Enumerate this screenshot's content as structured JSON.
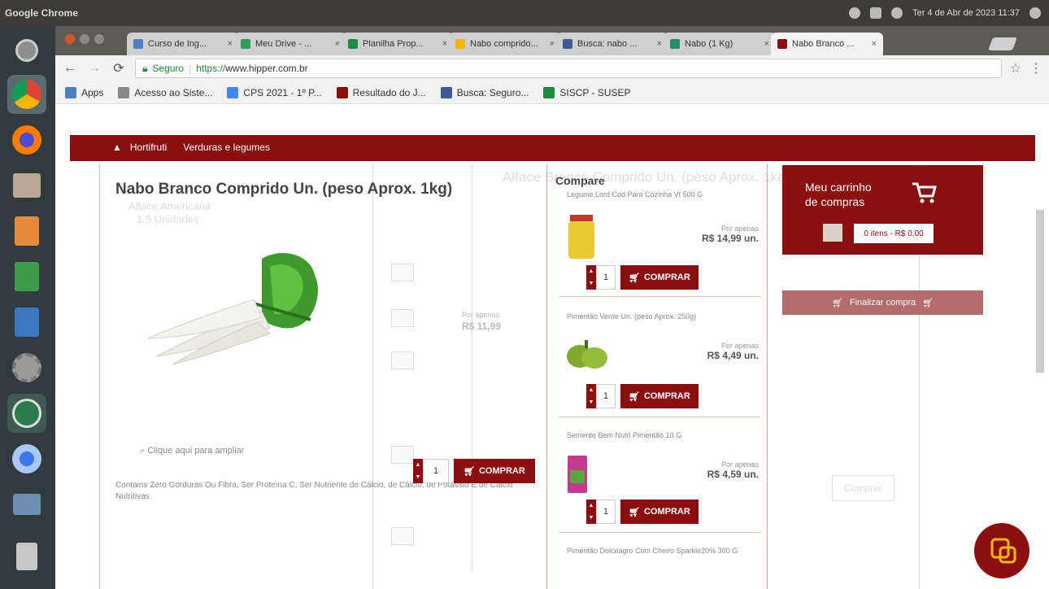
{
  "top_panel": {
    "app_name": "Google Chrome",
    "datetime": "Ter 4 de Abr de 2023 11:37"
  },
  "tabs": [
    {
      "label": "Curso de Ing...",
      "favicon_color": "#4e7fbf"
    },
    {
      "label": "Meu Drive - ...",
      "favicon_color": "#2f9e5a"
    },
    {
      "label": "Planilha Prop...",
      "favicon_color": "#1e8e3e"
    },
    {
      "label": "Nabo comprido...",
      "favicon_color": "#f2b705"
    },
    {
      "label": "Busca: nabo ...",
      "favicon_color": "#3b5998"
    },
    {
      "label": "Nabo (1 Kg)",
      "favicon_color": "#2b8a6e"
    },
    {
      "label": "Nabo Branco ...",
      "favicon_color": "#8b0f0f"
    }
  ],
  "toolbar": {
    "secure_label": "Seguro",
    "url_scheme": "https://",
    "url_host": "www.hipper.com.br"
  },
  "bookmarks": [
    {
      "label": "Apps",
      "color": "#4e7fbf"
    },
    {
      "label": "Acesso ao Siste...",
      "color": "#888888"
    },
    {
      "label": "CPS 2021 - 1º P...",
      "color": "#4285f4"
    },
    {
      "label": "Resultado do J...",
      "color": "#8b0f0f"
    },
    {
      "label": "Busca: Seguro...",
      "color": "#3b5998"
    },
    {
      "label": "SISCP - SUSEP",
      "color": "#1e8e3e"
    }
  ],
  "breadcrumb": {
    "home": "Hortifruti",
    "current": "Verduras e legumes"
  },
  "product": {
    "title": "Nabo Branco Comprido Un. (peso Aprox. 1kg)",
    "zoom_hint": "Clique aqui para ampliar",
    "description": "Contains Zero Gorduras Ou Fibra, Ser Proteína C, Ser Nutriente de Cálcio, de Cálcio, de Potássio E de Cálcio Nutritivas.",
    "qty": "1",
    "buy_label": "COMPRAR",
    "ghost_price_label": "Por apenas",
    "ghost_price": "R$ 11,99"
  },
  "compare": {
    "title": "Compare",
    "items": [
      {
        "name": "Legume Lord Cod Para Cozinha Vt 500 G",
        "price_label": "Por apenas",
        "price": "R$ 14,99 un.",
        "qty": "1",
        "buy_label": "COMPRAR"
      },
      {
        "name": "Pimentão Verde Un. (peso Aprox. 250g)",
        "price_label": "Por apenas",
        "price": "R$ 4,49 un.",
        "qty": "1",
        "buy_label": "COMPRAR"
      },
      {
        "name": "Semente Bem Nutri Pimentão 10 G",
        "price_label": "Por apenas",
        "price": "R$ 4,59 un.",
        "qty": "1",
        "buy_label": "COMPRAR"
      }
    ],
    "last_item_name": "Pimentão Dolceagro Com Cheiro Sparkle20% 300 G"
  },
  "cart": {
    "title_line1": "Meu carrinho",
    "title_line2": "de compras",
    "items_summary": "0 itens - R$ 0,00",
    "checkout_label": "Finalizar compra"
  },
  "ghost": {
    "title": "Alface Branco Comprido Un. (peso Aprox. 1kg)",
    "sub1": "Alface Americana",
    "sub2": "1.5 Unidades",
    "more": "Comprar"
  }
}
